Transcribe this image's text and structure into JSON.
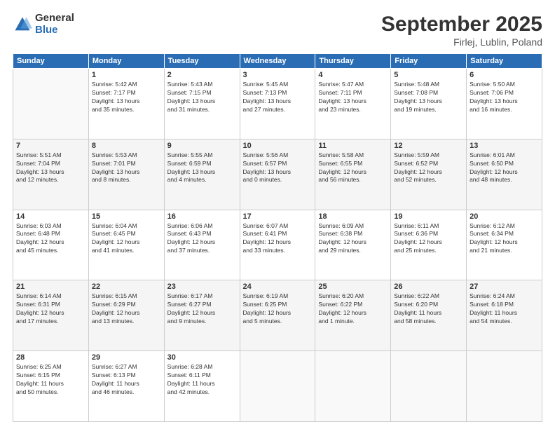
{
  "header": {
    "logo_general": "General",
    "logo_blue": "Blue",
    "month": "September 2025",
    "location": "Firlej, Lublin, Poland"
  },
  "days_of_week": [
    "Sunday",
    "Monday",
    "Tuesday",
    "Wednesday",
    "Thursday",
    "Friday",
    "Saturday"
  ],
  "weeks": [
    [
      {
        "day": "",
        "info": ""
      },
      {
        "day": "1",
        "info": "Sunrise: 5:42 AM\nSunset: 7:17 PM\nDaylight: 13 hours\nand 35 minutes."
      },
      {
        "day": "2",
        "info": "Sunrise: 5:43 AM\nSunset: 7:15 PM\nDaylight: 13 hours\nand 31 minutes."
      },
      {
        "day": "3",
        "info": "Sunrise: 5:45 AM\nSunset: 7:13 PM\nDaylight: 13 hours\nand 27 minutes."
      },
      {
        "day": "4",
        "info": "Sunrise: 5:47 AM\nSunset: 7:11 PM\nDaylight: 13 hours\nand 23 minutes."
      },
      {
        "day": "5",
        "info": "Sunrise: 5:48 AM\nSunset: 7:08 PM\nDaylight: 13 hours\nand 19 minutes."
      },
      {
        "day": "6",
        "info": "Sunrise: 5:50 AM\nSunset: 7:06 PM\nDaylight: 13 hours\nand 16 minutes."
      }
    ],
    [
      {
        "day": "7",
        "info": "Sunrise: 5:51 AM\nSunset: 7:04 PM\nDaylight: 13 hours\nand 12 minutes."
      },
      {
        "day": "8",
        "info": "Sunrise: 5:53 AM\nSunset: 7:01 PM\nDaylight: 13 hours\nand 8 minutes."
      },
      {
        "day": "9",
        "info": "Sunrise: 5:55 AM\nSunset: 6:59 PM\nDaylight: 13 hours\nand 4 minutes."
      },
      {
        "day": "10",
        "info": "Sunrise: 5:56 AM\nSunset: 6:57 PM\nDaylight: 13 hours\nand 0 minutes."
      },
      {
        "day": "11",
        "info": "Sunrise: 5:58 AM\nSunset: 6:55 PM\nDaylight: 12 hours\nand 56 minutes."
      },
      {
        "day": "12",
        "info": "Sunrise: 5:59 AM\nSunset: 6:52 PM\nDaylight: 12 hours\nand 52 minutes."
      },
      {
        "day": "13",
        "info": "Sunrise: 6:01 AM\nSunset: 6:50 PM\nDaylight: 12 hours\nand 48 minutes."
      }
    ],
    [
      {
        "day": "14",
        "info": "Sunrise: 6:03 AM\nSunset: 6:48 PM\nDaylight: 12 hours\nand 45 minutes."
      },
      {
        "day": "15",
        "info": "Sunrise: 6:04 AM\nSunset: 6:45 PM\nDaylight: 12 hours\nand 41 minutes."
      },
      {
        "day": "16",
        "info": "Sunrise: 6:06 AM\nSunset: 6:43 PM\nDaylight: 12 hours\nand 37 minutes."
      },
      {
        "day": "17",
        "info": "Sunrise: 6:07 AM\nSunset: 6:41 PM\nDaylight: 12 hours\nand 33 minutes."
      },
      {
        "day": "18",
        "info": "Sunrise: 6:09 AM\nSunset: 6:38 PM\nDaylight: 12 hours\nand 29 minutes."
      },
      {
        "day": "19",
        "info": "Sunrise: 6:11 AM\nSunset: 6:36 PM\nDaylight: 12 hours\nand 25 minutes."
      },
      {
        "day": "20",
        "info": "Sunrise: 6:12 AM\nSunset: 6:34 PM\nDaylight: 12 hours\nand 21 minutes."
      }
    ],
    [
      {
        "day": "21",
        "info": "Sunrise: 6:14 AM\nSunset: 6:31 PM\nDaylight: 12 hours\nand 17 minutes."
      },
      {
        "day": "22",
        "info": "Sunrise: 6:15 AM\nSunset: 6:29 PM\nDaylight: 12 hours\nand 13 minutes."
      },
      {
        "day": "23",
        "info": "Sunrise: 6:17 AM\nSunset: 6:27 PM\nDaylight: 12 hours\nand 9 minutes."
      },
      {
        "day": "24",
        "info": "Sunrise: 6:19 AM\nSunset: 6:25 PM\nDaylight: 12 hours\nand 5 minutes."
      },
      {
        "day": "25",
        "info": "Sunrise: 6:20 AM\nSunset: 6:22 PM\nDaylight: 12 hours\nand 1 minute."
      },
      {
        "day": "26",
        "info": "Sunrise: 6:22 AM\nSunset: 6:20 PM\nDaylight: 11 hours\nand 58 minutes."
      },
      {
        "day": "27",
        "info": "Sunrise: 6:24 AM\nSunset: 6:18 PM\nDaylight: 11 hours\nand 54 minutes."
      }
    ],
    [
      {
        "day": "28",
        "info": "Sunrise: 6:25 AM\nSunset: 6:15 PM\nDaylight: 11 hours\nand 50 minutes."
      },
      {
        "day": "29",
        "info": "Sunrise: 6:27 AM\nSunset: 6:13 PM\nDaylight: 11 hours\nand 46 minutes."
      },
      {
        "day": "30",
        "info": "Sunrise: 6:28 AM\nSunset: 6:11 PM\nDaylight: 11 hours\nand 42 minutes."
      },
      {
        "day": "",
        "info": ""
      },
      {
        "day": "",
        "info": ""
      },
      {
        "day": "",
        "info": ""
      },
      {
        "day": "",
        "info": ""
      }
    ]
  ]
}
